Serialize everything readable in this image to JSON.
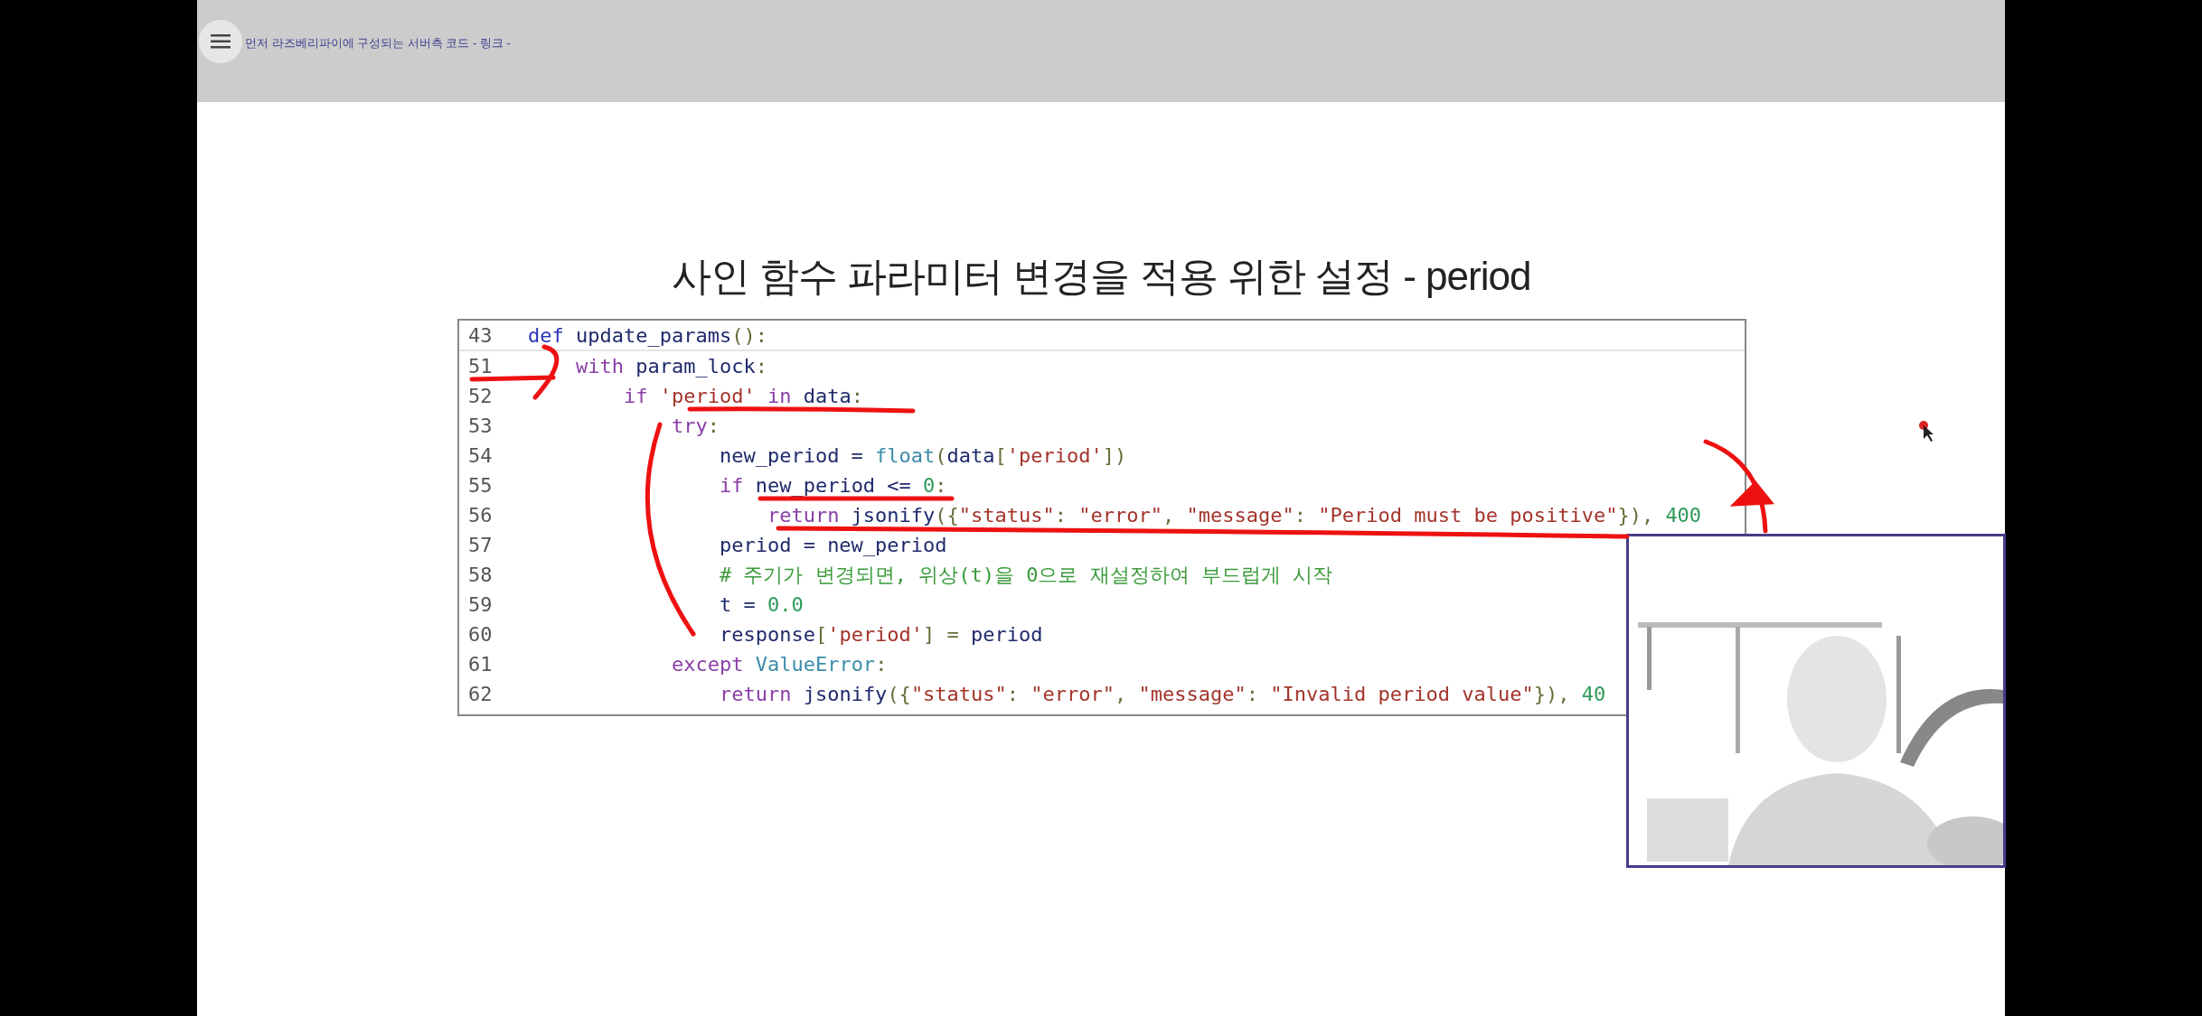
{
  "header": {
    "title": "먼저 라즈베리파이에 구성되는 서버측 코드 - 링크 -"
  },
  "slide": {
    "title": "사인 함수 파라미터 변경을 적용 위한 설정 - period",
    "code": [
      {
        "number": "43",
        "tokens": [
          {
            "kind": "def",
            "text": "def"
          },
          {
            "kind": "name",
            "text": " update_params"
          },
          {
            "kind": "punct",
            "text": "():"
          }
        ]
      },
      {
        "number": "51",
        "tokens": [
          {
            "kind": "kw",
            "text": "    with"
          },
          {
            "kind": "name",
            "text": " param_lock"
          },
          {
            "kind": "punct",
            "text": ":"
          }
        ]
      },
      {
        "number": "52",
        "tokens": [
          {
            "kind": "kw",
            "text": "        if"
          },
          {
            "kind": "str",
            "text": " 'period'"
          },
          {
            "kind": "kw",
            "text": " in"
          },
          {
            "kind": "name",
            "text": " data"
          },
          {
            "kind": "punct",
            "text": ":"
          }
        ]
      },
      {
        "number": "53",
        "tokens": [
          {
            "kind": "kw",
            "text": "            try"
          },
          {
            "kind": "punct",
            "text": ":"
          }
        ]
      },
      {
        "number": "54",
        "tokens": [
          {
            "kind": "name",
            "text": "                new_period = "
          },
          {
            "kind": "type",
            "text": "float"
          },
          {
            "kind": "punct",
            "text": "("
          },
          {
            "kind": "name",
            "text": "data"
          },
          {
            "kind": "punct",
            "text": "["
          },
          {
            "kind": "str",
            "text": "'period'"
          },
          {
            "kind": "punct",
            "text": "])"
          }
        ]
      },
      {
        "number": "55",
        "tokens": [
          {
            "kind": "kw",
            "text": "                if"
          },
          {
            "kind": "name",
            "text": " new_period <= "
          },
          {
            "kind": "num",
            "text": "0"
          },
          {
            "kind": "punct",
            "text": ":"
          }
        ]
      },
      {
        "number": "56",
        "tokens": [
          {
            "kind": "kw",
            "text": "                    return"
          },
          {
            "kind": "name",
            "text": " jsonify"
          },
          {
            "kind": "punct",
            "text": "({"
          },
          {
            "kind": "str",
            "text": "\"status\""
          },
          {
            "kind": "punct",
            "text": ": "
          },
          {
            "kind": "str",
            "text": "\"error\""
          },
          {
            "kind": "punct",
            "text": ", "
          },
          {
            "kind": "str",
            "text": "\"message\""
          },
          {
            "kind": "punct",
            "text": ": "
          },
          {
            "kind": "str",
            "text": "\"Period must be positive\""
          },
          {
            "kind": "punct",
            "text": "}), "
          },
          {
            "kind": "num",
            "text": "400"
          }
        ]
      },
      {
        "number": "57",
        "tokens": [
          {
            "kind": "name",
            "text": "                period = new_period"
          }
        ]
      },
      {
        "number": "58",
        "tokens": [
          {
            "kind": "com",
            "text": "                # 주기가 변경되면, 위상(t)을 0으로 재설정하여 부드럽게 시작"
          }
        ]
      },
      {
        "number": "59",
        "tokens": [
          {
            "kind": "name",
            "text": "                t = "
          },
          {
            "kind": "num",
            "text": "0.0"
          }
        ]
      },
      {
        "number": "60",
        "tokens": [
          {
            "kind": "name",
            "text": "                response"
          },
          {
            "kind": "punct",
            "text": "["
          },
          {
            "kind": "str",
            "text": "'period'"
          },
          {
            "kind": "punct",
            "text": "] = "
          },
          {
            "kind": "name",
            "text": "period"
          }
        ]
      },
      {
        "number": "61",
        "tokens": [
          {
            "kind": "kw",
            "text": "            except"
          },
          {
            "kind": "type",
            "text": " ValueError"
          },
          {
            "kind": "punct",
            "text": ":"
          }
        ]
      },
      {
        "number": "62",
        "tokens": [
          {
            "kind": "kw",
            "text": "                return"
          },
          {
            "kind": "name",
            "text": " jsonify"
          },
          {
            "kind": "punct",
            "text": "({"
          },
          {
            "kind": "str",
            "text": "\"status\""
          },
          {
            "kind": "punct",
            "text": ": "
          },
          {
            "kind": "str",
            "text": "\"error\""
          },
          {
            "kind": "punct",
            "text": ", "
          },
          {
            "kind": "str",
            "text": "\"message\""
          },
          {
            "kind": "punct",
            "text": ": "
          },
          {
            "kind": "str",
            "text": "\"Invalid period value\""
          },
          {
            "kind": "punct",
            "text": "}), "
          },
          {
            "kind": "num",
            "text": "40"
          }
        ]
      }
    ]
  }
}
